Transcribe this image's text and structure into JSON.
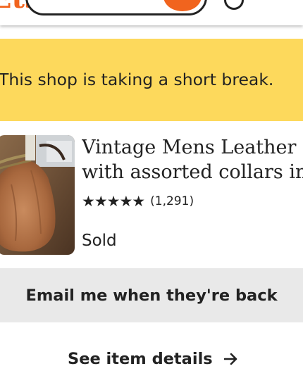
{
  "header": {
    "logo_text": "Etsy",
    "search_icon": "search-icon",
    "account_icon": "user-icon",
    "close_icon": "close-icon",
    "brand_color": "#F1641E"
  },
  "notice": {
    "text": "This shop is taking a short break.",
    "background": "#FDD95C"
  },
  "product": {
    "title_line1": "Vintage Mens Leather co",
    "title_line2": "with assorted collars inc",
    "stars": "★★★★★",
    "rating": 5,
    "review_count": "(1,291)",
    "status": "Sold",
    "image_subject": "leather bag"
  },
  "actions": {
    "email_label": "Email me when they're back",
    "details_label": "See item details",
    "details_icon": "arrow-right-icon"
  }
}
